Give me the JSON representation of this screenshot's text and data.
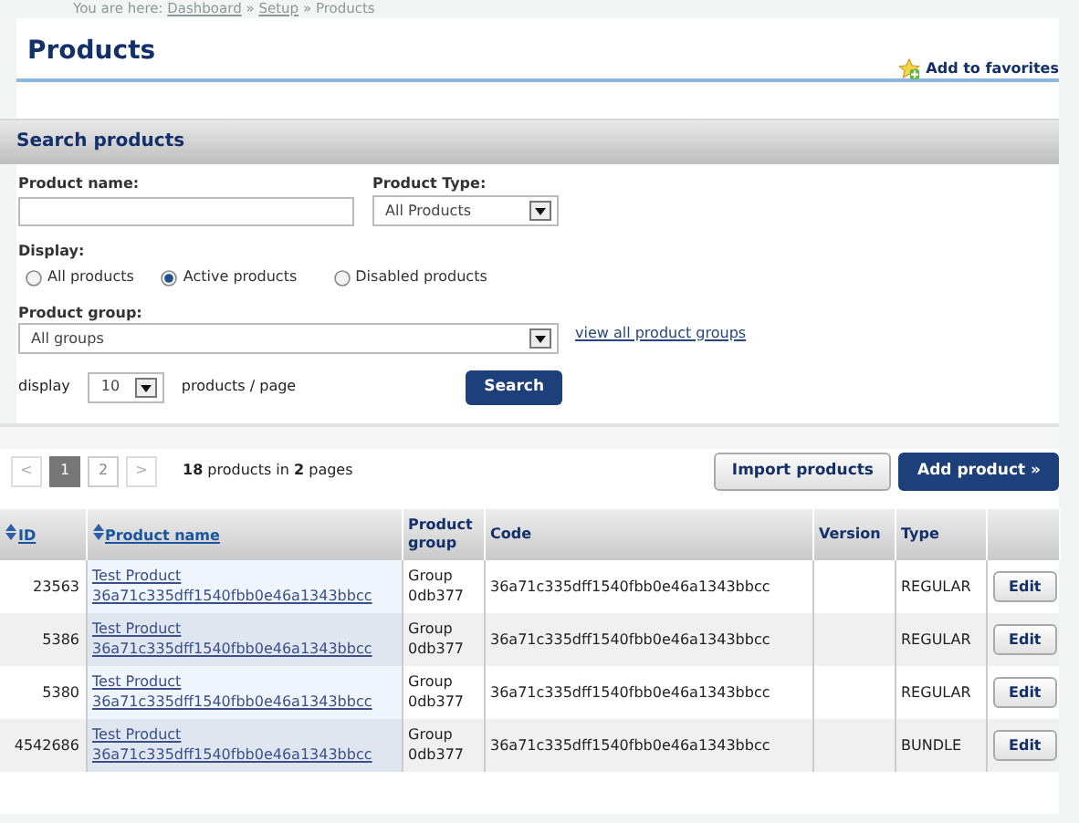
{
  "breadcrumb": {
    "label": "You are here:",
    "parts": [
      {
        "kind": "link",
        "text": "Dashboard"
      },
      {
        "kind": "separator",
        "text": "»"
      },
      {
        "kind": "link",
        "text": "Setup"
      },
      {
        "kind": "separator",
        "text": "»"
      },
      {
        "kind": "current",
        "text": "Products"
      }
    ]
  },
  "page_title": "Products",
  "favorites_link": "Add to favorites",
  "search": {
    "title": "Search products",
    "product_name": {
      "label": "Product name:"
    },
    "product_type": {
      "label": "Product Type:",
      "value": "All Products"
    },
    "display": {
      "label": "Display:",
      "options": [
        {
          "label": "All products",
          "selected": false
        },
        {
          "label": "Active products",
          "selected": true
        },
        {
          "label": "Disabled products",
          "selected": false
        }
      ]
    },
    "product_group": {
      "label": "Product group:",
      "value": "All groups",
      "link": "view all product groups"
    },
    "page_size": {
      "prefix": "display",
      "value": "10",
      "suffix": "products / page"
    },
    "button": "Search"
  },
  "pagination": {
    "pages": [
      {
        "label": "<",
        "kind": "arrow",
        "selected": false
      },
      {
        "label": "1",
        "kind": "page",
        "selected": true
      },
      {
        "label": "2",
        "kind": "page",
        "selected": false
      },
      {
        "label": ">",
        "kind": "arrow",
        "selected": false
      }
    ],
    "summary": "**18** products in **2** pages"
  },
  "buttons": [
    {
      "label": "Import products",
      "kind": "secondary"
    },
    {
      "label": "Add product »",
      "kind": "primary"
    }
  ],
  "table": {
    "columns": [
      {
        "label": "ID",
        "sortable": true
      },
      {
        "label": "Product name",
        "sortable": true
      },
      {
        "label": "Product group",
        "sortable": false
      },
      {
        "label": "Code",
        "sortable": false
      },
      {
        "label": "Version",
        "sortable": false
      },
      {
        "label": "Type",
        "sortable": false
      },
      {
        "sortable": false
      }
    ],
    "rows": [
      {
        "id": "23563",
        "name": "Test Product 36a71c335dff1540fbb0e46a1343bbcc",
        "group": "Group 0db377",
        "code": "36a71c335dff1540fbb0e46a1343bbcc",
        "type": "REGULAR",
        "action": "Edit"
      },
      {
        "id": "5386",
        "name": "Test Product 36a71c335dff1540fbb0e46a1343bbcc",
        "group": "Group 0db377",
        "code": "36a71c335dff1540fbb0e46a1343bbcc",
        "type": "REGULAR",
        "action": "Edit"
      },
      {
        "id": "5380",
        "name": "Test Product 36a71c335dff1540fbb0e46a1343bbcc",
        "group": "Group 0db377",
        "code": "36a71c335dff1540fbb0e46a1343bbcc",
        "type": "REGULAR",
        "action": "Edit"
      },
      {
        "id": "4542686",
        "name": "Test Product 36a71c335dff1540fbb0e46a1343bbcc",
        "group": "Group 0db377",
        "code": "36a71c335dff1540fbb0e46a1343bbcc",
        "type": "BUNDLE",
        "action": "Edit"
      }
    ]
  }
}
